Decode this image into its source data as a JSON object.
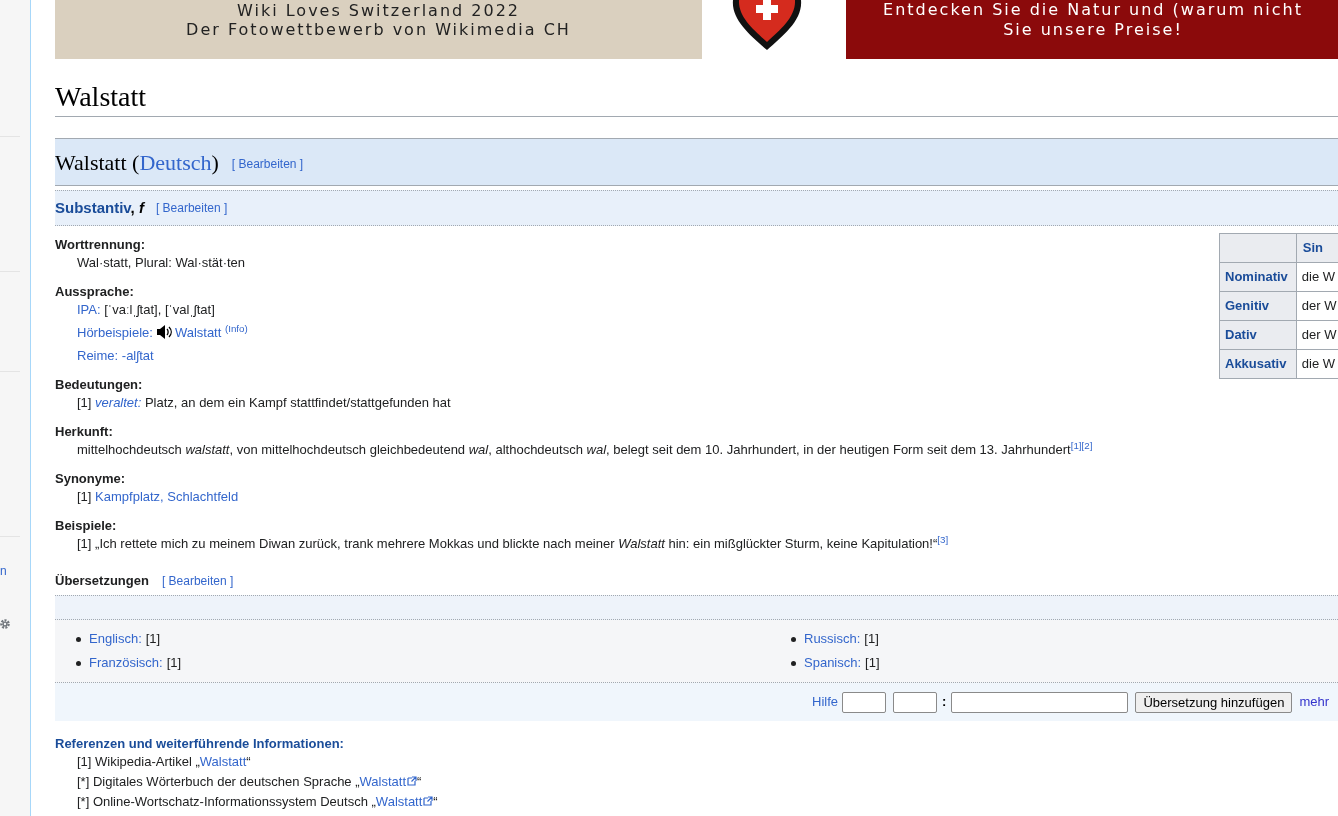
{
  "sidebar": {
    "link": "n"
  },
  "banner": {
    "left_lines": [
      "Wiki Loves Switzerland 2022",
      "Der Fotowettbewerb von Wikimedia CH"
    ],
    "right_lines": [
      "Entdecken Sie die Natur und (warum nicht",
      "Sie unsere Preise!"
    ]
  },
  "page_title": "Walstatt",
  "language_heading": {
    "word": "Walstatt",
    "open": "(",
    "language": "Deutsch",
    "close": ")",
    "edit": "[ Bearbeiten ]"
  },
  "pos_heading": {
    "pos": "Substantiv",
    "separator": ",",
    "gender": "f",
    "edit": "[ Bearbeiten ]"
  },
  "sections": [
    {
      "heading": "Worttrennung:",
      "lines": [
        [
          {
            "kind": "text",
            "text": "Wal·statt, Plural: Wal·stät·ten"
          }
        ]
      ]
    },
    {
      "heading": "Aussprache:",
      "lines": [
        [
          {
            "kind": "link",
            "text": "IPA:"
          },
          {
            "kind": "text",
            "text": " [ˈvaːlˌʃtat], [ˈvalˌʃtat]"
          }
        ],
        [
          {
            "kind": "link",
            "text": "Hörbeispiele:"
          },
          {
            "kind": "audio"
          },
          {
            "kind": "link",
            "text": "Walstatt"
          },
          {
            "kind": "link",
            "text": " $^{(Info)}$"
          }
        ],
        [
          {
            "kind": "link",
            "text": "Reime:"
          },
          {
            "kind": "link",
            "text": " -alʃtat"
          }
        ]
      ]
    },
    {
      "heading": "Bedeutungen:",
      "lines": [
        [
          {
            "kind": "text",
            "text": "[1] "
          },
          {
            "kind": "link",
            "text": "*veraltet:*"
          },
          {
            "kind": "text",
            "text": " Platz, an dem ein Kampf stattfindet/stattgefunden hat"
          }
        ]
      ]
    },
    {
      "heading": "Herkunft:",
      "lines": [
        [
          {
            "kind": "text",
            "text": "mittelhochdeutsch *walstatt*, von mittelhochdeutsch gleichbedeutend *wal*, althochdeutsch *wal*, belegt seit dem 10. Jahrhundert, in der heutigen Form seit dem 13. Jahrhundert"
          },
          {
            "kind": "link",
            "text": "$^{[1][2]}$"
          }
        ]
      ]
    },
    {
      "heading": "Synonyme:",
      "lines": [
        [
          {
            "kind": "text",
            "text": "[1] "
          },
          {
            "kind": "link",
            "text": "Kampfplatz, Schlachtfeld"
          }
        ]
      ]
    },
    {
      "heading": "Beispiele:",
      "lines": [
        [
          {
            "kind": "text",
            "text": "[1] „Ich rettete mich zu meinem Diwan zurück, trank mehrere Mokkas und blickte nach meiner *Walstatt* hin: ein mißglückter Sturm, keine Kapitulation!“"
          },
          {
            "kind": "link",
            "text": "$^{[3]}$"
          }
        ]
      ]
    }
  ],
  "declension_table": {
    "header": "Sin",
    "rows": [
      {
        "case": "Nominativ",
        "value": "die W"
      },
      {
        "case": "Genitiv",
        "value": "der W"
      },
      {
        "case": "Dativ",
        "value": "der W"
      },
      {
        "case": "Akkusativ",
        "value": "die W"
      }
    ]
  },
  "translations": {
    "heading": "Übersetzungen",
    "edit": "[ Bearbeiten ]",
    "columns": [
      [
        {
          "language": "Englisch:",
          "refs": "[1]"
        },
        {
          "language": "Französisch:",
          "refs": "[1]"
        }
      ],
      [
        {
          "language": "Russisch:",
          "refs": "[1]"
        },
        {
          "language": "Spanisch:",
          "refs": "[1]"
        }
      ]
    ],
    "form": {
      "help": "Hilfe",
      "colon": ":",
      "button": "Übersetzung hinzufügen",
      "more": "mehr"
    }
  },
  "references": {
    "heading": "Referenzen und weiterführende Informationen:",
    "lines": [
      [
        {
          "kind": "text",
          "text": "[1] Wikipedia-Artikel „"
        },
        {
          "kind": "link",
          "text": "Walstatt"
        },
        {
          "kind": "text",
          "text": "“"
        }
      ],
      [
        {
          "kind": "text",
          "text": "[*] Digitales Wörterbuch der deutschen Sprache „"
        },
        {
          "kind": "link",
          "text": "Walstatt"
        },
        {
          "kind": "extlink"
        },
        {
          "kind": "text",
          "text": "“"
        }
      ],
      [
        {
          "kind": "text",
          "text": "[*] Online-Wortschatz-Informationssystem Deutsch „"
        },
        {
          "kind": "link",
          "text": "Walstatt"
        },
        {
          "kind": "extlink"
        },
        {
          "kind": "text",
          "text": "“"
        }
      ]
    ]
  }
}
